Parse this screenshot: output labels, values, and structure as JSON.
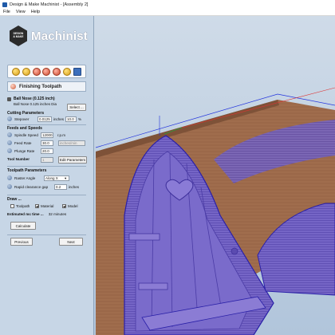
{
  "window": {
    "title": "Design & Make Machinist - [Assembly 2]"
  },
  "menu": [
    "File",
    "View",
    "Help"
  ],
  "logo": {
    "badge_line1": "DESIGN",
    "badge_line2": "& MAKE",
    "wordmark": "Machinist"
  },
  "toolbar": {
    "icons": [
      "toolpath-icon",
      "drill-icon",
      "roughing-icon",
      "finishing-icon",
      "profile-icon",
      "simulate-icon",
      "save-icon"
    ]
  },
  "section": {
    "title": "Finishing Toolpath"
  },
  "tool": {
    "name": "Ball Nose (0.125 inch)",
    "description": "Ball Nose 0.125 inches Dia",
    "select_label": "Select ..."
  },
  "cutting": {
    "header": "Cutting Parameters",
    "stepover_label": "Stepover",
    "stepover_value": "0.0125",
    "stepover_unit": "inches",
    "stepover_percent": "10.0",
    "percent_sign": "%"
  },
  "feeds": {
    "header": "Feeds and Speeds",
    "spindle_label": "Spindle Speed",
    "spindle_value": "12000",
    "spindle_unit": "r.p.m",
    "feed_label": "Feed Rate",
    "feed_value": "30.0",
    "units_select": "inches/min",
    "plunge_label": "Plunge Rate",
    "plunge_value": "20.0"
  },
  "tool_number": {
    "label": "Tool Number",
    "value": "1",
    "edit_label": "Edit Parameters"
  },
  "toolpath": {
    "header": "Toolpath Parameters",
    "raster_label": "Raster Angle",
    "raster_value": "Along X",
    "gap_label": "Rapid clearance gap",
    "gap_value": "0.2",
    "gap_unit": "inches"
  },
  "draw": {
    "header": "Draw ...",
    "toolpath_label": "Toolpath",
    "toolpath_checked": false,
    "material_label": "Material",
    "material_checked": true,
    "model_label": "Model",
    "model_checked": true
  },
  "estimate": {
    "label": "Estimated mc time ...",
    "value": "32 minutes"
  },
  "actions": {
    "calculate": "Calculate",
    "previous": "Previous",
    "next": "Next"
  },
  "colors": {
    "panel": "#c7d6e6",
    "viewport": "#b9cbe0",
    "model": "#7a66c9",
    "wood": "#9d6b4b",
    "toolpath_blue": "#2233dd"
  }
}
